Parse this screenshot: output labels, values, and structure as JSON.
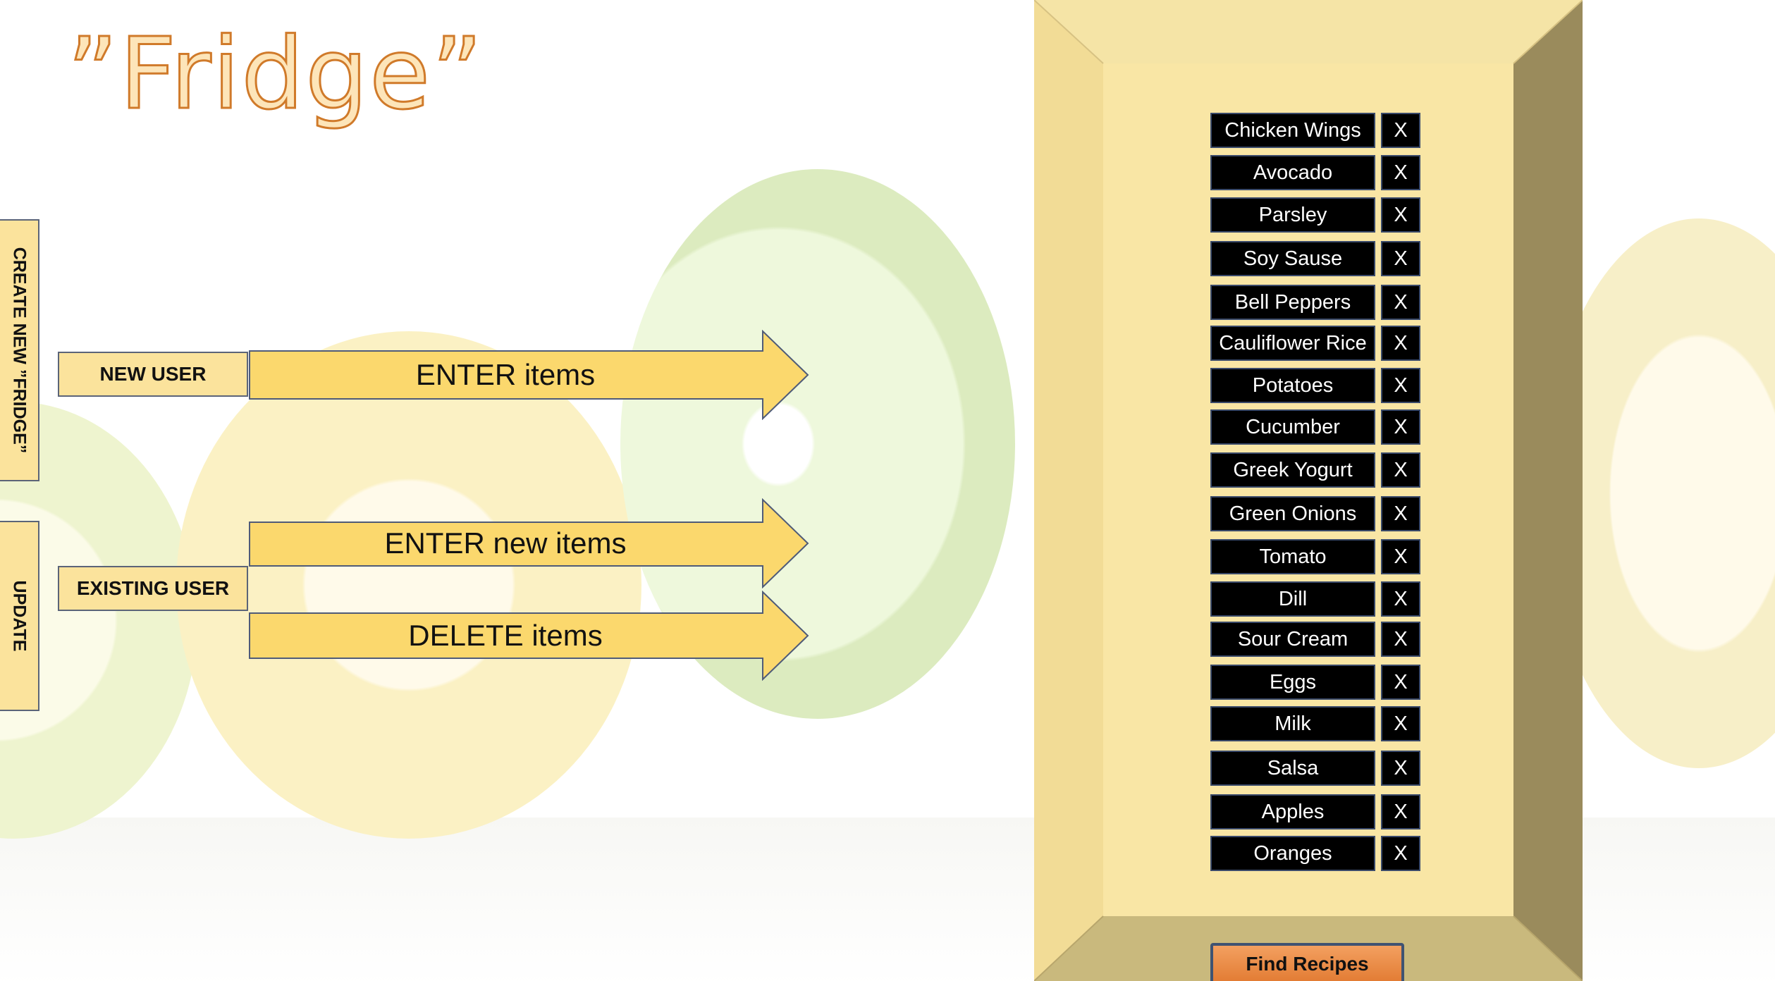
{
  "title": "”Fridge”",
  "side_buttons": {
    "create": "CREATE NEW ”FRIDGE”",
    "update": "UPDATE"
  },
  "users": {
    "new_user": "NEW USER",
    "existing_user": "EXISTING USER"
  },
  "arrows": {
    "enter_items": "ENTER items",
    "enter_new_items": "ENTER new items",
    "delete_items": "DELETE items"
  },
  "fridge": {
    "items": [
      {
        "name": "Chicken Wings",
        "delete": "X"
      },
      {
        "name": "Avocado",
        "delete": "X"
      },
      {
        "name": "Parsley",
        "delete": "X"
      },
      {
        "name": "Soy Sause",
        "delete": "X"
      },
      {
        "name": "Bell Peppers",
        "delete": "X"
      },
      {
        "name": "Cauliflower Rice",
        "delete": "X"
      },
      {
        "name": "Potatoes",
        "delete": "X"
      },
      {
        "name": "Cucumber",
        "delete": "X"
      },
      {
        "name": "Greek Yogurt",
        "delete": "X"
      },
      {
        "name": "Green Onions",
        "delete": "X"
      },
      {
        "name": "Tomato",
        "delete": "X"
      },
      {
        "name": "Dill",
        "delete": "X"
      },
      {
        "name": "Sour Cream",
        "delete": "X"
      },
      {
        "name": "Eggs",
        "delete": "X"
      },
      {
        "name": "Milk",
        "delete": "X"
      },
      {
        "name": "Salsa",
        "delete": "X"
      },
      {
        "name": "Apples",
        "delete": "X"
      },
      {
        "name": "Oranges",
        "delete": "X"
      }
    ],
    "find_recipes": "Find Recipes"
  },
  "colors": {
    "button_fill": "#fbe39c",
    "title_outline": "#d07a2a",
    "find_recipes": "#e98a45",
    "frame_inner": "#f9e6a5",
    "frame_side": "#9a8b5c"
  }
}
